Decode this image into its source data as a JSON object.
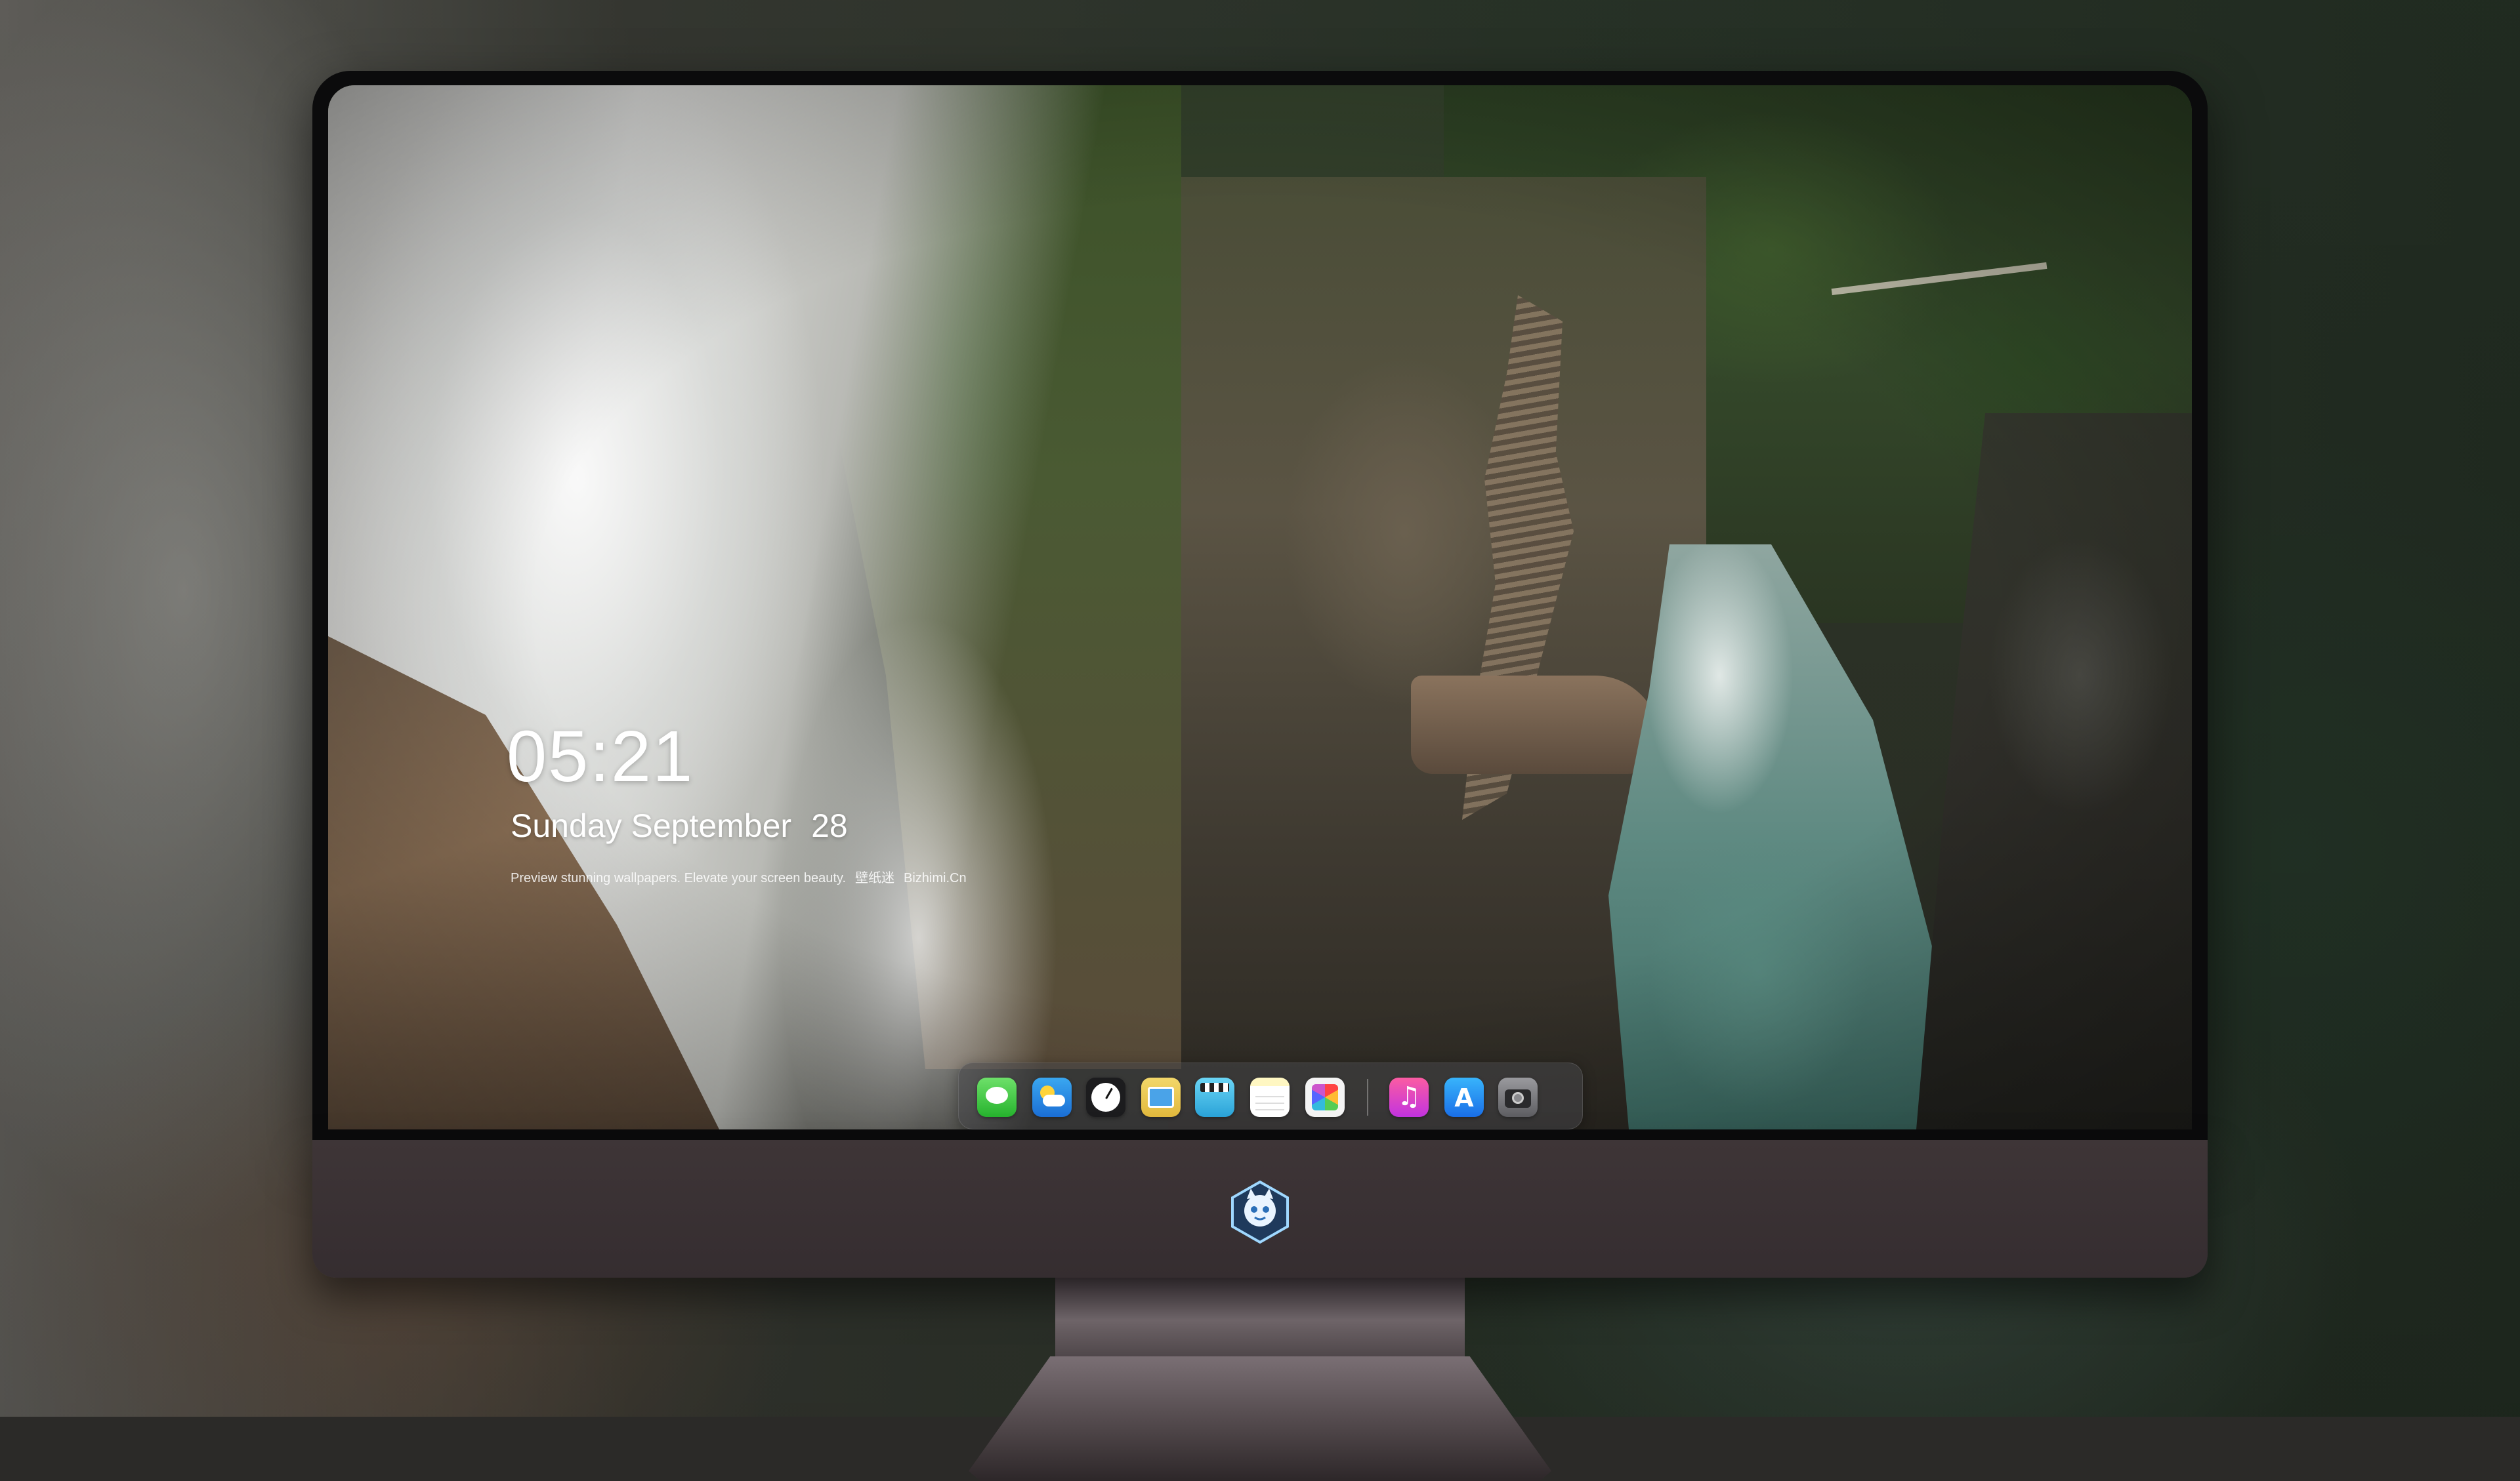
{
  "lock_screen": {
    "time": "05:21",
    "weekday_month": "Sunday September",
    "day": "28",
    "tagline_parts": [
      "Preview stunning wallpapers. Elevate your screen beauty.",
      "壁纸迷",
      "Bizhimi.Cn"
    ]
  },
  "dock": {
    "apps": [
      {
        "name": "messages-icon"
      },
      {
        "name": "weather-icon"
      },
      {
        "name": "clock-icon"
      },
      {
        "name": "preview-icon"
      },
      {
        "name": "imovie-icon"
      },
      {
        "name": "notes-icon"
      },
      {
        "name": "photos-icon"
      },
      {
        "name": "music-icon"
      },
      {
        "name": "app-store-icon"
      },
      {
        "name": "camera-icon"
      }
    ]
  },
  "monitor": {
    "chin_logo": "mascot-logo-icon",
    "chin_color": "#3e3537",
    "bezel_color": "#0b0b0c"
  }
}
